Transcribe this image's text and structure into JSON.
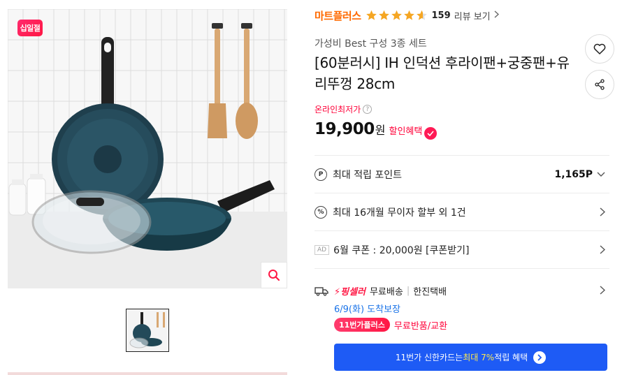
{
  "gallery": {
    "badge_label": "십일절",
    "zoom_icon": "search-icon"
  },
  "header": {
    "brand": "마트플러스",
    "rating": 4.6,
    "review_count": "159",
    "review_link": "리뷰 보기"
  },
  "product": {
    "subtitle": "가성비 Best 구성 3종 세트",
    "title": "[60분러시] IH 인덕션 후라이팬+궁중팬+유리뚜껑 28cm"
  },
  "price": {
    "lowest_label": "온라인최저가",
    "amount": "19,900",
    "unit": "원",
    "discount_label": "할인혜택"
  },
  "rows": {
    "points_label": "최대 적립 포인트",
    "points_value": "1,165P",
    "installment_label": "최대 16개월 무이자 할부 외 1건",
    "coupon_ad": "AD",
    "coupon_label": "6월 쿠폰 : 20,000원 [쿠폰받기]"
  },
  "shipping": {
    "seller_logo": "⚡핑셀러",
    "free": "무료배송",
    "courier": "한진택배",
    "arrival": "6/9(화) 도착보장",
    "plus_tag": "11번가플러스",
    "plus_text": "무료반품/교환"
  },
  "card": {
    "prefix": "11번가 신한카드는 ",
    "highlight": "최대 7%",
    "suffix": " 적립 혜택"
  },
  "colors": {
    "brand": "#ff6a00",
    "accent_red": "#ff0038",
    "star": "#f5a623",
    "card_blue": "#1e5bf5",
    "arrival_blue": "#1a73e8"
  }
}
